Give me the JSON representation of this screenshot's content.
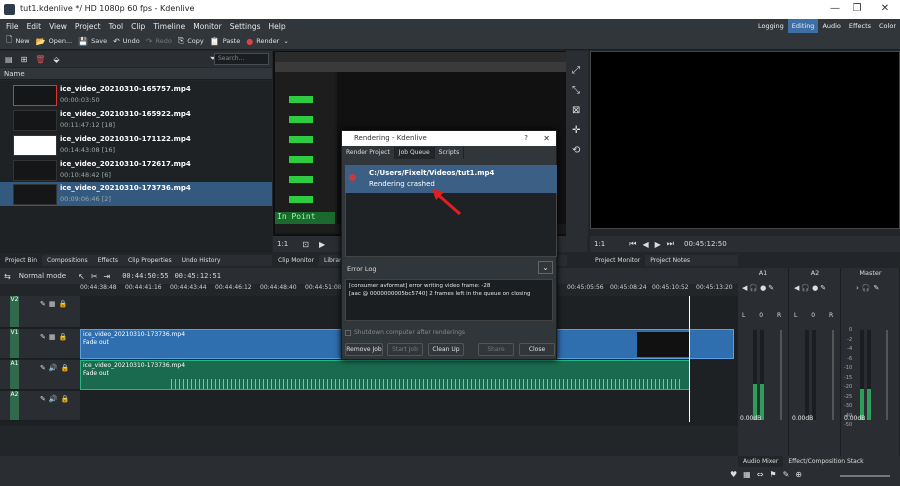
{
  "window": {
    "title": "tut1.kdenlive */ HD 1080p 60 fps - Kdenlive",
    "controls": [
      "—",
      "❐",
      "✕"
    ]
  },
  "menu": [
    "File",
    "Edit",
    "View",
    "Project",
    "Tool",
    "Clip",
    "Timeline",
    "Monitor",
    "Settings",
    "Help"
  ],
  "workspaces": [
    {
      "label": "Logging",
      "active": false
    },
    {
      "label": "Editing",
      "active": true
    },
    {
      "label": "Audio",
      "active": false
    },
    {
      "label": "Effects",
      "active": false
    },
    {
      "label": "Color",
      "active": false
    }
  ],
  "toolbar": [
    {
      "icon": "new-icon",
      "glyph": "🗋",
      "label": "New",
      "enabled": true
    },
    {
      "icon": "open-icon",
      "glyph": "📂",
      "label": "Open...",
      "enabled": true
    },
    {
      "icon": "save-icon",
      "glyph": "💾",
      "label": "Save",
      "enabled": true
    },
    {
      "icon": "undo-icon",
      "glyph": "↶",
      "label": "Undo",
      "enabled": true
    },
    {
      "icon": "redo-icon",
      "glyph": "↷",
      "label": "Redo",
      "enabled": false
    },
    {
      "icon": "copy-icon",
      "glyph": "⎘",
      "label": "Copy",
      "enabled": true
    },
    {
      "icon": "paste-icon",
      "glyph": "📋",
      "label": "Paste",
      "enabled": true
    },
    {
      "icon": "render-icon",
      "glyph": "●",
      "label": "Render",
      "enabled": true
    }
  ],
  "bin": {
    "search_placeholder": "Search...",
    "column_header": "Name",
    "clips": [
      {
        "name": "ice_video_20210310-165757.mp4",
        "duration": "00:00:03:50",
        "selected": false
      },
      {
        "name": "ice_video_20210310-165922.mp4",
        "duration": "00:11:47:12 [18]",
        "selected": false
      },
      {
        "name": "ice_video_20210310-171122.mp4",
        "duration": "00:14:43:08 [16]",
        "selected": false
      },
      {
        "name": "ice_video_20210310-172617.mp4",
        "duration": "00:10:48:42 [6]",
        "selected": false
      },
      {
        "name": "ice_video_20210310-173736.mp4",
        "duration": "00:09:06:46 [2]",
        "selected": true
      }
    ]
  },
  "left_tabs": [
    "Project Bin",
    "Compositions",
    "Effects",
    "Clip Properties",
    "Undo History"
  ],
  "clip_monitor": {
    "overlay_text": "In Point",
    "zoom": "1:1",
    "tabs": [
      "Clip Monitor",
      "Library"
    ]
  },
  "project_monitor": {
    "zoom": "1:1",
    "timecode": "00:45:12:50",
    "tabs": [
      "Project Monitor",
      "Project Notes"
    ]
  },
  "timeline": {
    "mode": "Normal mode",
    "position": "00:44:50:55",
    "duration": "00:45:12:51",
    "ruler": [
      "00:44:38:48",
      "00:44:41:16",
      "00:44:43:44",
      "00:44:46:12",
      "00:44:48:40",
      "00:44:51:08",
      "00:45:05:56",
      "00:45:08:24",
      "00:45:10:52",
      "00:45:13:20"
    ],
    "tracks": [
      {
        "label": "V2",
        "kind": "video"
      },
      {
        "label": "V1",
        "kind": "video",
        "clip": "ice_video_20210310-173736.mp4",
        "effect": "Fade out"
      },
      {
        "label": "A1",
        "kind": "audio",
        "clip": "ice_video_20210310-173736.mp4",
        "effect": "Fade out"
      },
      {
        "label": "A2",
        "kind": "audio"
      }
    ]
  },
  "mixer": {
    "channels": [
      {
        "name": "A1",
        "db": "0.00dB"
      },
      {
        "name": "A2",
        "db": "0.00dB"
      },
      {
        "name": "Master",
        "db": "0.00dB"
      }
    ],
    "scale": [
      "0",
      "-2",
      "-4",
      "-6",
      "-10",
      "-15",
      "-20",
      "-25",
      "-30",
      "-40",
      "-50"
    ],
    "lr": [
      "L",
      "0",
      "R"
    ]
  },
  "bottom_tabs": [
    "Audio Mixer",
    "Effect/Composition Stack"
  ],
  "dialog": {
    "title": "Rendering - Kdenlive",
    "help": "?",
    "close": "✕",
    "tabs": [
      {
        "label": "Render Project",
        "active": false
      },
      {
        "label": "Job Queue",
        "active": true
      },
      {
        "label": "Scripts",
        "active": false
      }
    ],
    "job": {
      "path": "C:/Users/Fixelt/Videos/tut1.mp4",
      "status": "Rendering crashed"
    },
    "error_log_label": "Error Log",
    "error_log": [
      "[consumer avformat] error writing video frame: -28",
      "[aac @ 0000000005bc5740] 2 frames left in the queue on closing"
    ],
    "shutdown_label": "Shutdown computer after renderings",
    "buttons": {
      "remove": "Remove Job",
      "start": "Start Job",
      "cleanup": "Clean Up",
      "share": "Share",
      "close": "Close"
    }
  }
}
